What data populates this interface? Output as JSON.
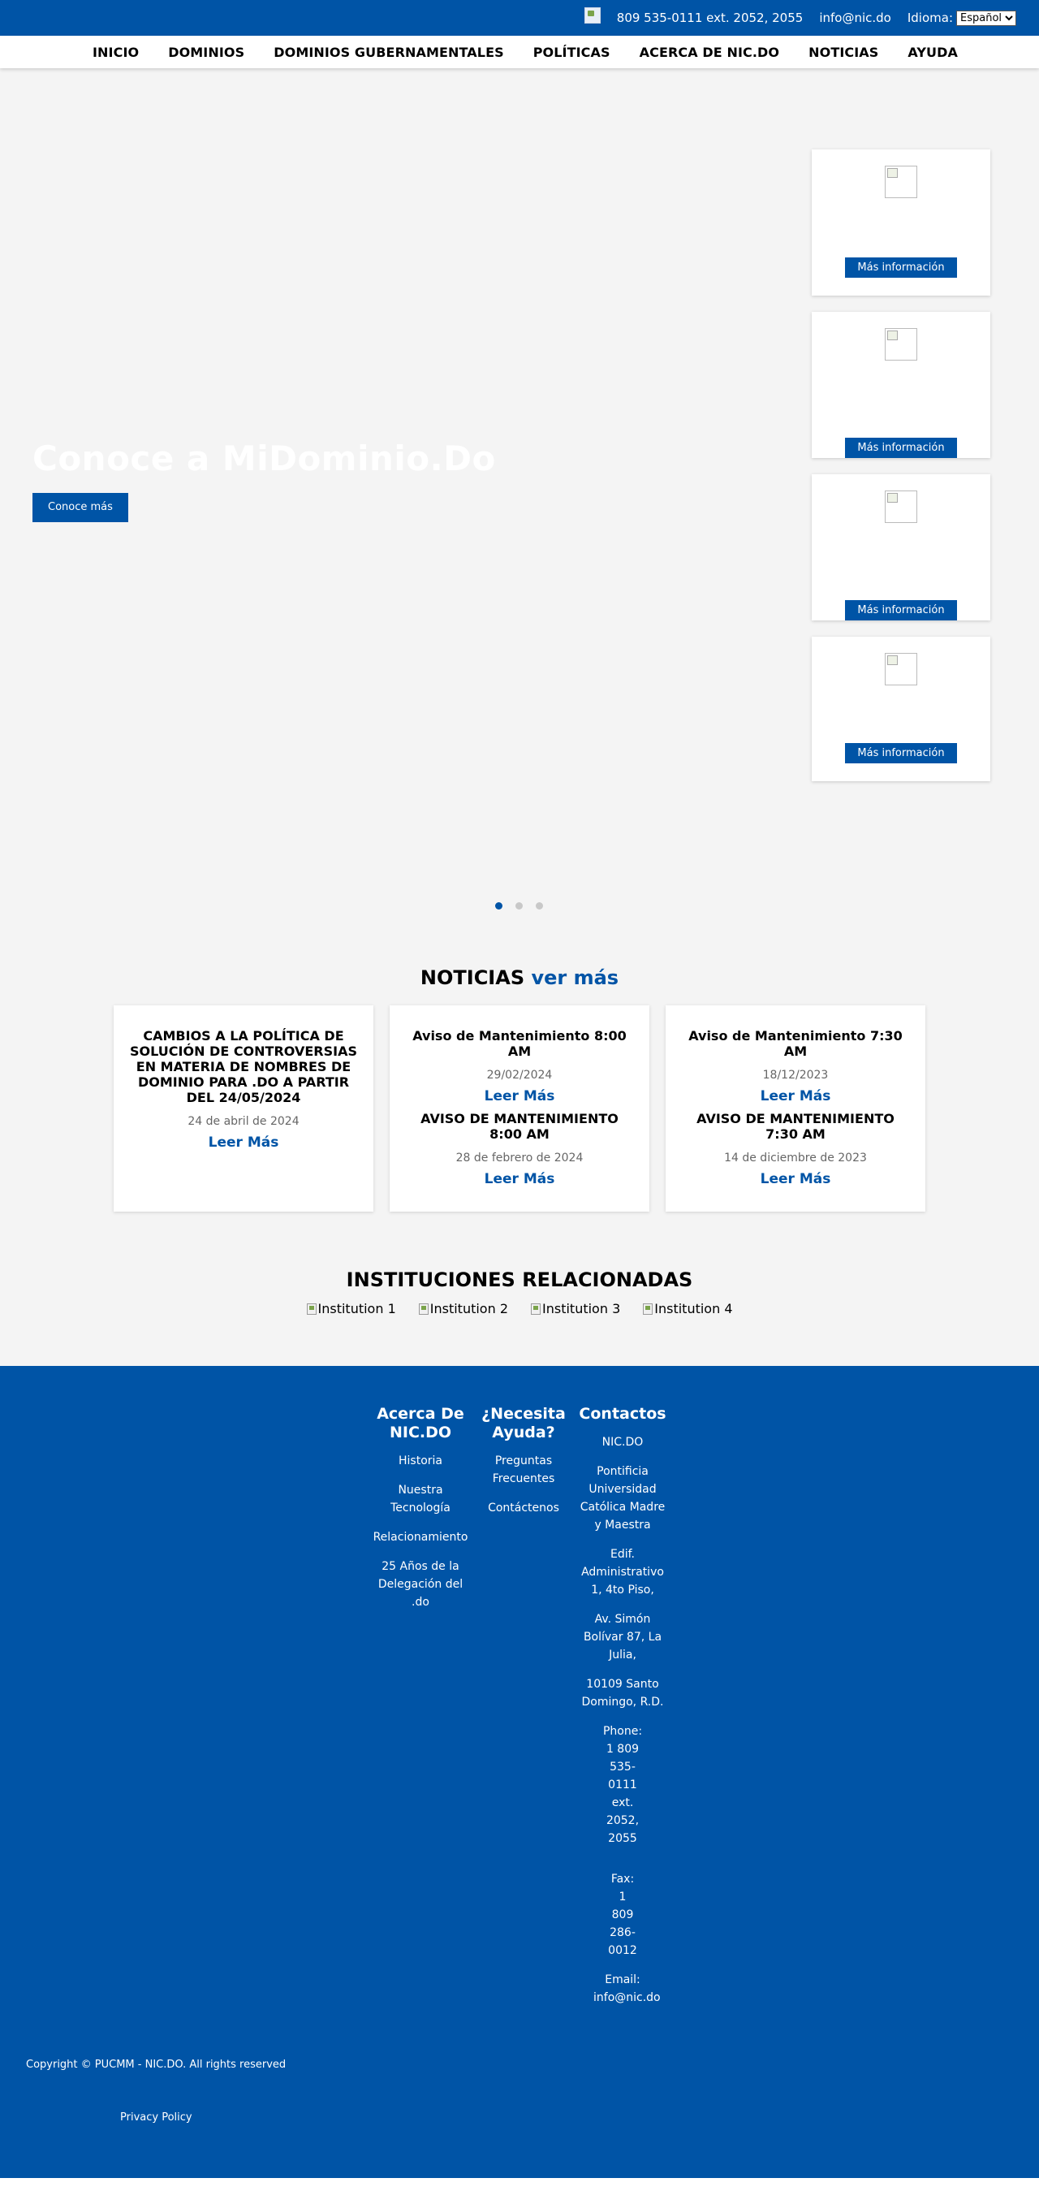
{
  "topbar": {
    "phone": "809 535-0111 ext. 2052, 2055",
    "email": "info@nic.do",
    "language_label": "Idioma:",
    "language_selected": "Español",
    "colors": {
      "background": "#0054a6",
      "text": "#ffffff"
    }
  },
  "nav": {
    "items": [
      {
        "label": "INICIO"
      },
      {
        "label": "DOMINIOS"
      },
      {
        "label": "DOMINIOS GUBERNAMENTALES"
      },
      {
        "label": "POLÍTICAS"
      },
      {
        "label": "ACERCA DE NIC.DO"
      },
      {
        "label": "NOTICIAS"
      },
      {
        "label": "AYUDA"
      }
    ]
  },
  "hero": {
    "title": "Conoce a MiDominio.Do",
    "button_label": "Conoce más",
    "side_cards": [
      {
        "button_label": "Más información"
      },
      {
        "button_label": "Más información"
      },
      {
        "button_label": "Más información"
      },
      {
        "button_label": "Más información"
      }
    ],
    "slides_count": 3,
    "active_slide": 1
  },
  "news": {
    "heading": "NOTICIAS",
    "more_link": "ver más",
    "cards": [
      {
        "title": "CAMBIOS A LA POLÍTICA DE SOLUCIÓN DE CONTROVERSIAS EN MATERIA DE NOMBRES DE DOMINIO PARA .DO A PARTIR DEL 24/05/2024",
        "date": "24 de abril de 2024",
        "link": "Leer Más"
      },
      {
        "title": "Aviso de Mantenimiento 8:00 AM",
        "date": "29/02/2024",
        "link": "Leer Más",
        "title2": "AVISO DE MANTENIMIENTO 8:00 AM",
        "date2": "28 de febrero de 2024",
        "link2": "Leer Más"
      },
      {
        "title": "Aviso de Mantenimiento 7:30 AM",
        "date": "18/12/2023",
        "link": "Leer Más",
        "title2": "AVISO DE MANTENIMIENTO 7:30 AM",
        "date2": "14 de diciembre de 2023",
        "link2": "Leer Más"
      }
    ]
  },
  "institutions": {
    "heading": "INSTITUCIONES RELACIONADAS",
    "logos": [
      "Institution 1",
      "Institution 2",
      "Institution 3",
      "Institution 4"
    ]
  },
  "footer": {
    "about": {
      "heading": "Acerca De NIC.DO",
      "items": [
        "Historia",
        "Nuestra Tecnología",
        "Relacionamiento",
        "25 Años de la Delegación del .do"
      ]
    },
    "help": {
      "heading": "¿Necesita Ayuda?",
      "items": [
        "Preguntas Frecuentes",
        "Contáctenos"
      ]
    },
    "contacts": {
      "heading": "Contactos",
      "org": "NIC.DO",
      "university": "Pontificia Universidad Católica Madre y Maestra",
      "building": "Edif. Administrativo 1, 4to Piso,",
      "street": "Av. Simón Bolívar 87, La Julia,",
      "city": "10109 Santo Domingo, R.D.",
      "phone": "Phone: 1 809 535-0111 ext. 2052, 2055",
      "fax": "Fax: 1 809 286-0012",
      "email": "Email: info@nic.do"
    },
    "copyright": "Copyright © PUCMM - NIC.DO. All rights reserved",
    "privacy": "Privacy Policy",
    "colors": {
      "background": "#0054a6"
    }
  }
}
